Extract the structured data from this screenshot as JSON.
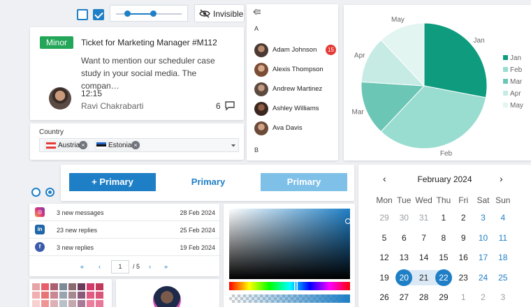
{
  "top_controls": {
    "invisible_label": "Invisible"
  },
  "ticket": {
    "badge": "Minor",
    "title": "Ticket for Marketing Manager #M112",
    "body": "Want to mention our scheduler case study in your social media. The compan…",
    "time": "12:15",
    "author": "Ravi Chakrabarti",
    "comments": "6"
  },
  "country": {
    "label": "Country",
    "tags": [
      "Austria",
      "Estonia"
    ]
  },
  "contacts": {
    "letter_a": "A",
    "letter_b": "B",
    "items": [
      "Adam Johnson",
      "Alexis Thompson",
      "Andrew Martinez",
      "Ashley Williams",
      "Ava Davis"
    ],
    "unread": "15"
  },
  "pie": {
    "slices": [
      {
        "name": "Jan",
        "value": 28,
        "color": "#0e9b7e"
      },
      {
        "name": "Feb",
        "value": 34,
        "color": "#99dcd0"
      },
      {
        "name": "Mar",
        "value": 14,
        "color": "#6cc6b6"
      },
      {
        "name": "Apr",
        "value": 12,
        "color": "#c6ebe4"
      },
      {
        "name": "May",
        "value": 12,
        "color": "#e3f5f1"
      }
    ]
  },
  "buttons": {
    "primary_icon": "+",
    "primary1": "Primary",
    "primary2": "Primary",
    "primary3": "Primary"
  },
  "notifications": {
    "rows": [
      {
        "icon": "instagram-icon",
        "text": "3 new messages",
        "date": "28 Feb 2024"
      },
      {
        "icon": "linkedin-icon",
        "text": "23 new replies",
        "date": "25 Feb 2024"
      },
      {
        "icon": "facebook-icon",
        "text": "3 new replies",
        "date": "19 Feb 2024"
      }
    ],
    "pager": {
      "page": "1",
      "total": "/ 5"
    }
  },
  "calendar": {
    "title": "February 2024",
    "dow": [
      "Mon",
      "Tue",
      "Wed",
      "Thu",
      "Fri",
      "Sat",
      "Sun"
    ],
    "weeks": [
      [
        "29",
        "30",
        "31",
        "1",
        "2",
        "3",
        "4"
      ],
      [
        "5",
        "6",
        "7",
        "8",
        "9",
        "10",
        "11"
      ],
      [
        "12",
        "13",
        "14",
        "15",
        "16",
        "17",
        "18"
      ],
      [
        "19",
        "20",
        "21",
        "22",
        "23",
        "24",
        "25"
      ],
      [
        "26",
        "27",
        "28",
        "29",
        "1",
        "2",
        "3"
      ]
    ],
    "range_start": "20",
    "range_end": "22"
  },
  "colors": {
    "accent": "#1f7fc6",
    "green": "#23a657",
    "teal": "#0e9b7e"
  }
}
